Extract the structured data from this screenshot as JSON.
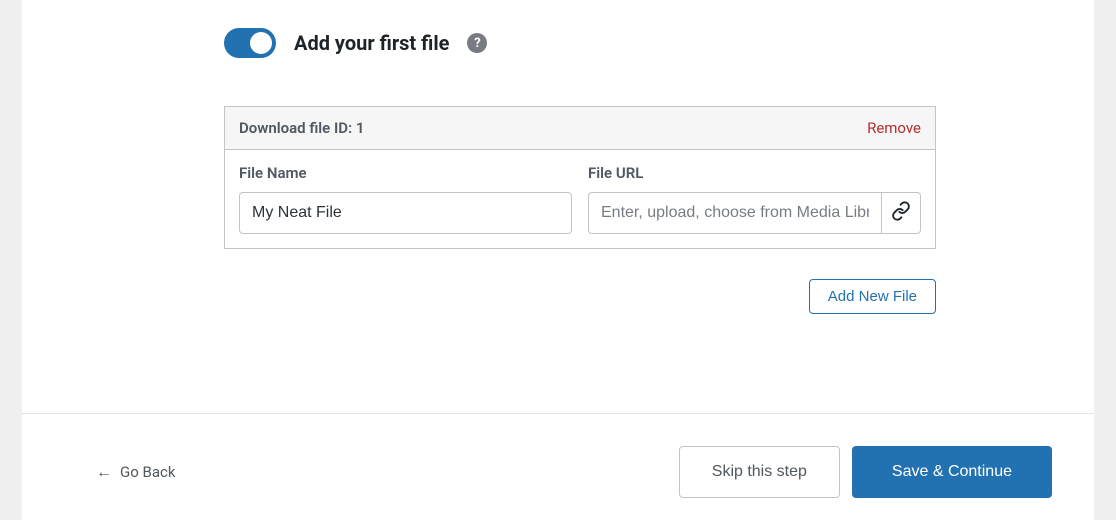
{
  "header": {
    "title": "Add your first file"
  },
  "fileBox": {
    "idLabel": "Download file ID: 1",
    "removeLabel": "Remove",
    "fileNameLabel": "File Name",
    "fileNameValue": "My Neat File",
    "fileUrlLabel": "File URL",
    "fileUrlPlaceholder": "Enter, upload, choose from Media Library"
  },
  "buttons": {
    "addNewFile": "Add New File",
    "goBack": "Go Back",
    "skip": "Skip this step",
    "save": "Save & Continue"
  }
}
